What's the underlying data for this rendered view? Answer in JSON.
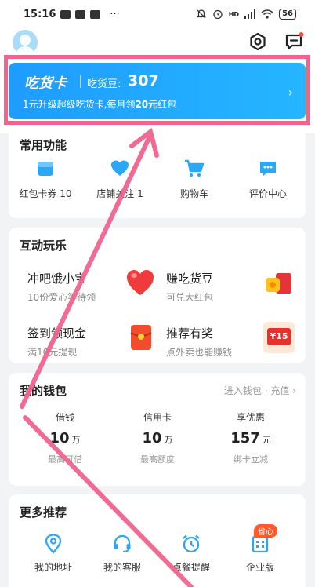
{
  "status_bar": {
    "time": "15:16",
    "more": "···",
    "network": "HD",
    "battery": "56"
  },
  "header": {
    "settings_icon": "settings-hex-icon",
    "message_icon": "message-icon"
  },
  "card": {
    "title": "吃货卡",
    "bean_label": "吃货豆:",
    "bean_value": "307",
    "sub_prefix": "1元升级超级吃货卡,每月领",
    "sub_highlight": "20元",
    "sub_suffix": "红包",
    "accent": "#1e9cff"
  },
  "common": {
    "title": "常用功能",
    "items": [
      {
        "label": "红包卡券 10",
        "icon": "coupon-icon"
      },
      {
        "label": "店铺关注 1",
        "icon": "heart-icon"
      },
      {
        "label": "购物车",
        "icon": "cart-icon"
      },
      {
        "label": "评价中心",
        "icon": "review-icon"
      }
    ]
  },
  "games": {
    "title": "互动玩乐",
    "items": [
      {
        "title": "冲吧饿小宝",
        "sub": "10份爱心等待领",
        "icon": "heart-3d-icon"
      },
      {
        "title": "赚吃货豆",
        "sub": "可兑大红包",
        "icon": "bean-bag-icon"
      },
      {
        "title": "签到领现金",
        "sub": "满10元提现",
        "icon": "red-envelope-icon"
      },
      {
        "title": "推荐有奖",
        "sub": "点外卖也能赚钱",
        "icon": "reward-envelope-icon",
        "tag": "¥15"
      }
    ]
  },
  "wallet": {
    "title": "我的钱包",
    "more": "进入钱包 · 充值",
    "items": [
      {
        "title": "借钱",
        "value": "10",
        "unit": "万",
        "sub": "最高可借"
      },
      {
        "title": "信用卡",
        "value": "10",
        "unit": "万",
        "sub": "最高额度"
      },
      {
        "title": "享优惠",
        "value": "157",
        "unit": "元",
        "sub": "绑卡立减"
      }
    ]
  },
  "recommend": {
    "title": "更多推荐",
    "items": [
      {
        "label": "我的地址",
        "icon": "location-icon"
      },
      {
        "label": "我的客服",
        "icon": "headset-icon"
      },
      {
        "label": "点餐提醒",
        "icon": "alarm-icon"
      },
      {
        "label": "企业版",
        "icon": "building-icon",
        "badge": "省心"
      }
    ]
  },
  "colors": {
    "highlight_frame": "#f0648f",
    "icon_blue": "#2aa7f5"
  }
}
